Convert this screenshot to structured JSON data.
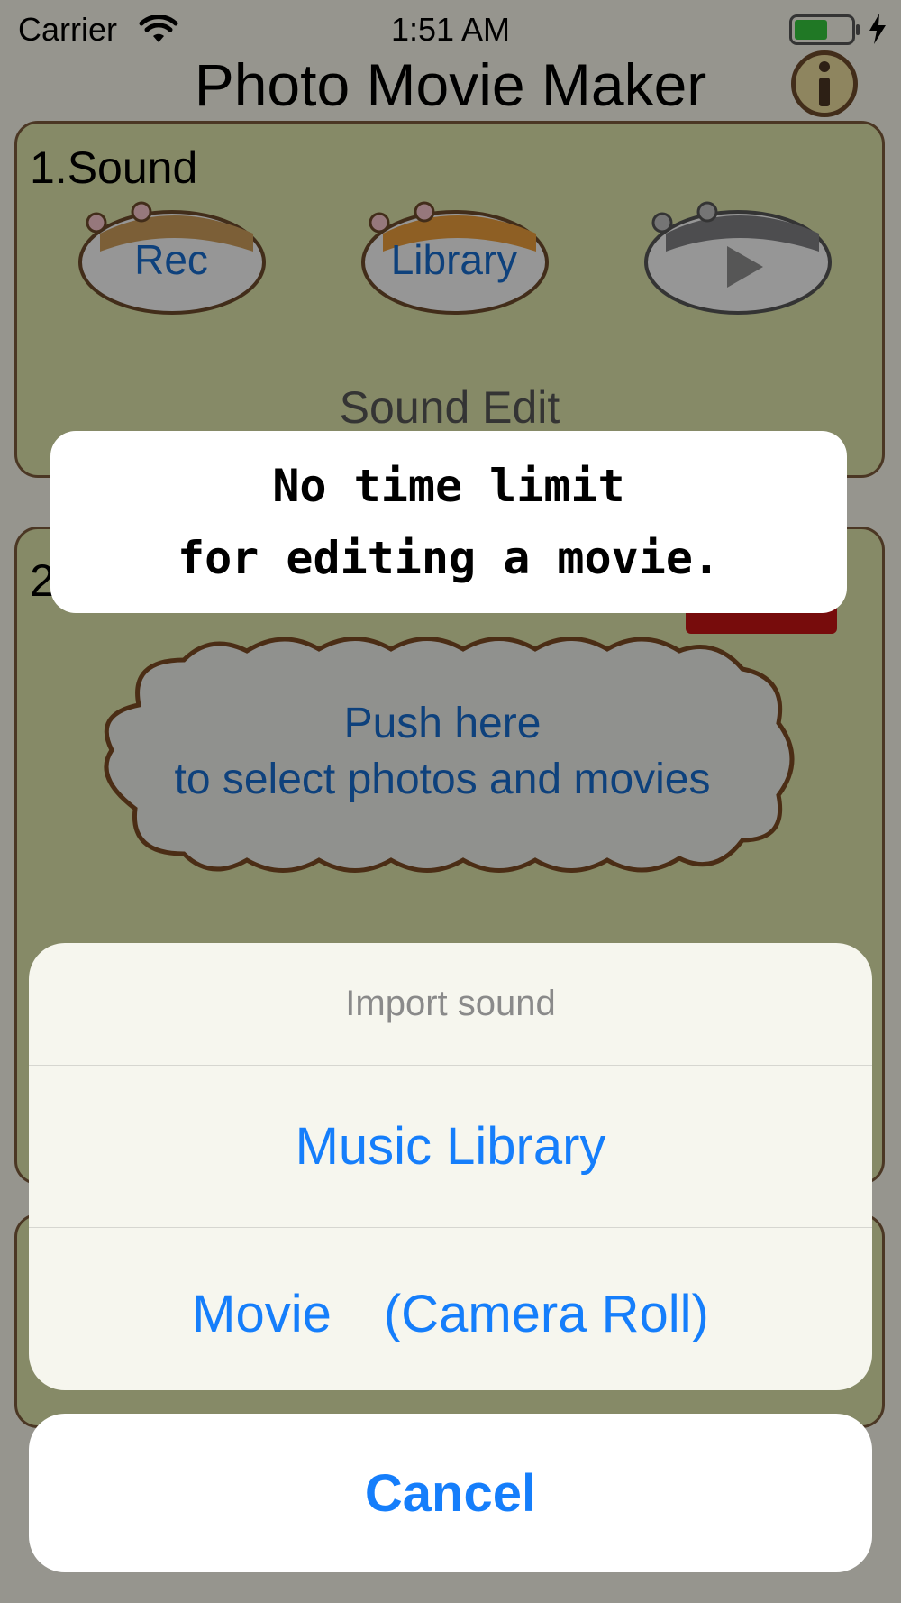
{
  "status_bar": {
    "carrier": "Carrier",
    "time": "1:51 AM"
  },
  "header": {
    "title": "Photo Movie Maker",
    "info_icon_glyph": "i"
  },
  "sound_panel": {
    "title": "1.Sound",
    "buttons": {
      "rec": "Rec",
      "library": "Library",
      "play_icon": "play-icon"
    },
    "sound_edit": "Sound Edit"
  },
  "photos_panel": {
    "number": "2",
    "cloud_line1": "Push here",
    "cloud_line2": "to select photos and movies"
  },
  "promo": {
    "line1": "No time limit",
    "line2": "for editing a movie."
  },
  "action_sheet": {
    "title": "Import sound",
    "actions": [
      {
        "label": "Music Library"
      },
      {
        "label": "Movie　(Camera Roll)"
      }
    ],
    "cancel": "Cancel"
  },
  "colors": {
    "accent": "#157efb",
    "link_blue": "#1769c9",
    "panel": "#d9dfa6",
    "panel_border": "#7a5a3a"
  }
}
